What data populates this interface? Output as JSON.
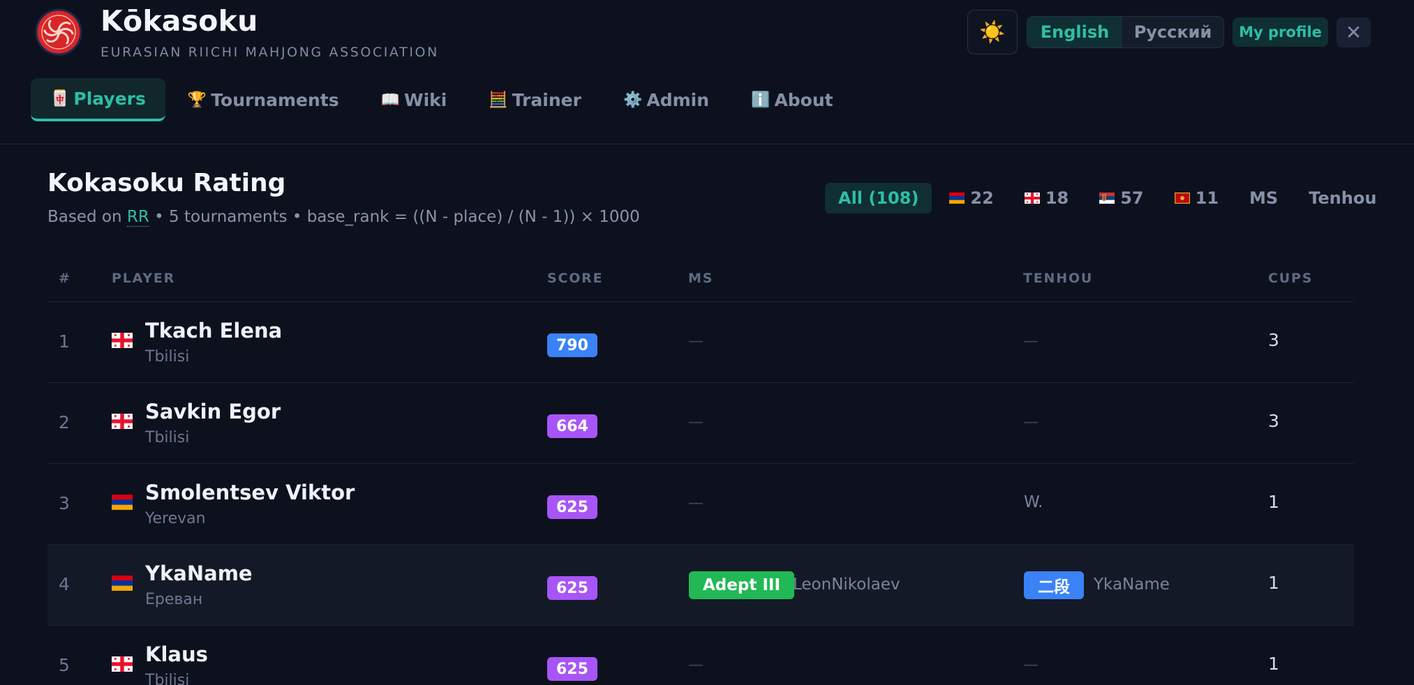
{
  "header": {
    "title": "Kōkasoku",
    "subtitle": "EURASIAN RIICHI MAHJONG ASSOCIATION",
    "theme_icon": "☀️",
    "languages": [
      "English",
      "Русский"
    ],
    "active_language": "English",
    "profile_label": "My profile",
    "close_label": "✕"
  },
  "nav": [
    {
      "icon": "🀄",
      "label": "Players",
      "active": true
    },
    {
      "icon": "🏆",
      "label": "Tournaments",
      "active": false
    },
    {
      "icon": "📖",
      "label": "Wiki",
      "active": false
    },
    {
      "icon": "🧮",
      "label": "Trainer",
      "active": false
    },
    {
      "icon": "⚙️",
      "label": "Admin",
      "active": false
    },
    {
      "icon": "ℹ️",
      "label": "About",
      "active": false
    }
  ],
  "section": {
    "title": "Kokasoku Rating",
    "desc_prefix": "Based on ",
    "desc_link": "RR",
    "desc_suffix": " • 5 tournaments • base_rank = ((N - place) / (N - 1)) × 1000"
  },
  "filters": [
    {
      "label": "All (108)",
      "flag": "",
      "active": true
    },
    {
      "label": "22",
      "flag": "armenia",
      "active": false
    },
    {
      "label": "18",
      "flag": "georgia",
      "active": false
    },
    {
      "label": "57",
      "flag": "serbia",
      "active": false
    },
    {
      "label": "11",
      "flag": "montenegro",
      "active": false
    },
    {
      "label": "MS",
      "flag": "",
      "active": false
    },
    {
      "label": "Tenhou",
      "flag": "",
      "active": false
    }
  ],
  "table": {
    "headers": {
      "rank": "#",
      "player": "PLAYER",
      "score": "SCORE",
      "ms": "MS",
      "tenhou": "TENHOU",
      "cups": "CUPS"
    },
    "rows": [
      {
        "rank": "1",
        "flag": "georgia",
        "name": "Tkach Elena",
        "city": "Tbilisi",
        "score": "790",
        "score_color": "#3b82f6",
        "ms_rank": "",
        "ms_name": "—",
        "tenhou_rank": "",
        "tenhou_name": "—",
        "cups": "3"
      },
      {
        "rank": "2",
        "flag": "georgia",
        "name": "Savkin Egor",
        "city": "Tbilisi",
        "score": "664",
        "score_color": "#a855f7",
        "ms_rank": "",
        "ms_name": "—",
        "tenhou_rank": "",
        "tenhou_name": "—",
        "cups": "3"
      },
      {
        "rank": "3",
        "flag": "armenia",
        "name": "Smolentsev Viktor",
        "city": "Yerevan",
        "score": "625",
        "score_color": "#a855f7",
        "ms_rank": "",
        "ms_name": "—",
        "tenhou_rank": "",
        "tenhou_name": "W.",
        "cups": "1"
      },
      {
        "rank": "4",
        "flag": "armenia",
        "name": "YkaName",
        "city": "Ереван",
        "score": "625",
        "score_color": "#a855f7",
        "ms_rank": "Adept III",
        "ms_name": "LeonNikolaev",
        "tenhou_rank": "二段",
        "tenhou_name": "YkaName",
        "cups": "1"
      },
      {
        "rank": "5",
        "flag": "georgia",
        "name": "Klaus",
        "city": "Tbilisi",
        "score": "625",
        "score_color": "#a855f7",
        "ms_rank": "",
        "ms_name": "—",
        "tenhou_rank": "",
        "tenhou_name": "—",
        "cups": "1"
      }
    ]
  },
  "colors": {
    "accent": "#2ebea5",
    "background": "#0c111d",
    "score_blue": "#3b82f6",
    "score_purple": "#a855f7",
    "ms_badge": "#22b856",
    "tenhou_badge": "#3b82f6"
  }
}
